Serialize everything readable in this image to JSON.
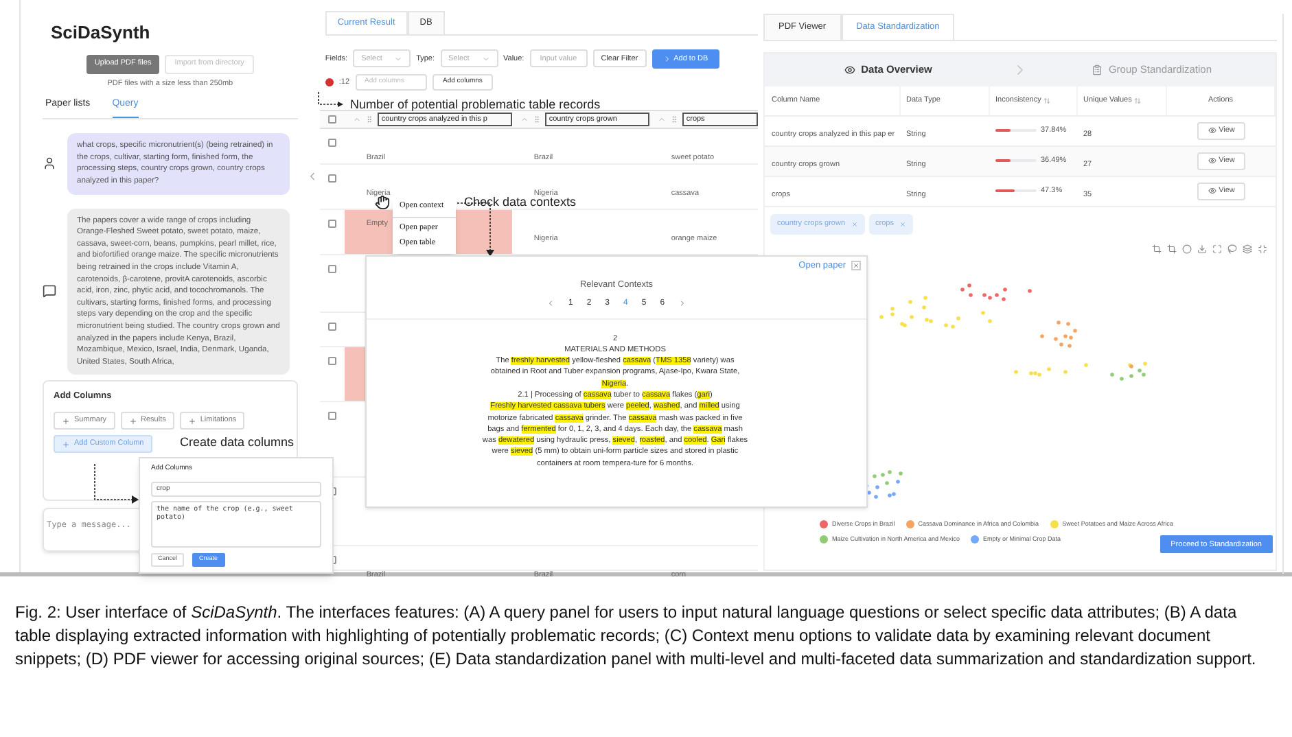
{
  "left_panel": {
    "title": "SciDaSynth",
    "buttons": [
      {
        "label": "Upload PDF files",
        "disabled": false
      },
      {
        "label": "Import from directory",
        "disabled": true
      }
    ],
    "hint": "PDF files with a size less than 250mb",
    "tabs": [
      {
        "label": "Paper lists",
        "selected": false
      },
      {
        "label": "Query",
        "selected": true
      }
    ],
    "messages": [
      {
        "kind": "user",
        "text": "what crops, specific micronutrient(s) (being retrained) in the crops, cultivar, starting form, finished form, the processing steps, country crops grown, country crops analyzed in this paper?"
      },
      {
        "kind": "bot",
        "text": "The papers cover a wide range of crops including Orange-Fleshed Sweet potato, sweet potato, maize, cassava, sweet-corn, beans, pumpkins, pearl millet, rice, and biofortified orange maize. The specific micronutrients being retrained in the crops include Vitamin A, carotenoids, β-carotene, provitA carotenoids, ascorbic acid, iron, zinc, phytic acid, and tocochromanols. The cultivars, starting forms, finished forms, and processing steps vary depending on the crop and the specific micronutrient being studied. The country crops grown and analyzed in the papers include Kenya, Brazil, Mozambique, Mexico, Israel, India, Denmark, Uganda, United States, South Africa,"
      }
    ],
    "add_columns": {
      "title": "Add Columns",
      "buttons": [
        {
          "label": "Summary",
          "kind": "preset"
        },
        {
          "label": "Results",
          "kind": "preset"
        },
        {
          "label": "Limitations",
          "kind": "preset"
        },
        {
          "label": "Add Custom Column",
          "kind": "custom"
        }
      ]
    },
    "message_input": {
      "placeholder": "Type a message..."
    }
  },
  "add_columns_dialog": {
    "title": "Add Columns",
    "name_value": "crop",
    "description_value": "the name of the crop (e.g., sweet potato)",
    "buttons": [
      {
        "label": "Cancel",
        "kind": "secondary"
      },
      {
        "label": "Create",
        "kind": "primary"
      }
    ]
  },
  "middle_panel": {
    "tabs": [
      {
        "label": "Current Result",
        "selected": true
      },
      {
        "label": "DB",
        "selected": false
      }
    ],
    "filters": [
      {
        "label": "Fields:",
        "kind": "select",
        "placeholder": "Select"
      },
      {
        "label": "Type:",
        "kind": "select",
        "placeholder": "Select"
      },
      {
        "label": "Value:",
        "kind": "input",
        "placeholder": "Input value"
      }
    ],
    "clear_filter": "Clear Filter",
    "add_to_db": "Add to DB",
    "problem_count": ":12",
    "add_columns_placeholder": "Add columns",
    "add_columns_button": "Add columns",
    "table": {
      "columns": [
        "country crops analyzed in this p",
        "country crops grown",
        "crops"
      ],
      "select_all_checked": false,
      "rows": [
        {
          "checked": false,
          "flagged": false,
          "cells": [
            "Brazil",
            "Brazil",
            "sweet potato"
          ]
        },
        {
          "checked": false,
          "flagged": false,
          "cells": [
            "Nigeria",
            "Nigeria",
            "cassava"
          ]
        },
        {
          "checked": false,
          "flagged": true,
          "cells": [
            "Empty",
            "Nigeria",
            "orange maize"
          ]
        },
        {
          "checked": false,
          "flagged": false
        },
        {
          "checked": false,
          "flagged": false
        },
        {
          "checked": false,
          "flagged": true
        },
        {
          "checked": false,
          "flagged": false
        },
        {
          "checked": false,
          "flagged": false
        },
        {
          "checked": false,
          "flagged": false,
          "cells": [
            "Brazil",
            "Brazil",
            "corn"
          ]
        }
      ]
    }
  },
  "context_menu": {
    "items": [
      "Open context",
      "Open paper",
      "Open table"
    ]
  },
  "contexts_popup": {
    "open_paper": "Open paper",
    "title": "Relevant Contexts",
    "pages": [
      {
        "label": "1",
        "selected": false
      },
      {
        "label": "2",
        "selected": false
      },
      {
        "label": "3",
        "selected": false
      },
      {
        "label": "4",
        "selected": true
      },
      {
        "label": "5",
        "selected": false
      },
      {
        "label": "6",
        "selected": false
      }
    ],
    "paragraphs": [
      [
        {
          "text": "2",
          "highlighted": false
        }
      ],
      [
        {
          "text": "MATERIALS AND METHODS",
          "highlighted": false
        }
      ],
      [
        {
          "text": "The ",
          "highlighted": false
        },
        {
          "text": "freshly harvested",
          "highlighted": true
        },
        {
          "text": " yellow-fleshed ",
          "highlighted": false
        },
        {
          "text": "cassava",
          "highlighted": true
        },
        {
          "text": " (",
          "highlighted": false
        },
        {
          "text": "TMS 1358",
          "highlighted": true
        },
        {
          "text": " variety) was obtained in Root and Tuber expansion programs, Ajase-Ipo, Kwara State, ",
          "highlighted": false
        },
        {
          "text": "Nigeria",
          "highlighted": true
        },
        {
          "text": ".",
          "highlighted": false
        }
      ],
      [
        {
          "text": "2.1 | Processing of ",
          "highlighted": false
        },
        {
          "text": "cassava",
          "highlighted": true
        },
        {
          "text": " tuber to ",
          "highlighted": false
        },
        {
          "text": "cassava",
          "highlighted": true
        },
        {
          "text": " flakes (",
          "highlighted": false
        },
        {
          "text": "gari",
          "highlighted": true
        },
        {
          "text": ")",
          "highlighted": false
        }
      ],
      [
        {
          "text": "Freshly harvested cassava tubers",
          "highlighted": true
        },
        {
          "text": " were ",
          "highlighted": false
        },
        {
          "text": "peeled",
          "highlighted": true
        },
        {
          "text": ", ",
          "highlighted": false
        },
        {
          "text": "washed",
          "highlighted": true
        },
        {
          "text": ", and ",
          "highlighted": false
        },
        {
          "text": "milled",
          "highlighted": true
        },
        {
          "text": " using motorize fabricated ",
          "highlighted": false
        },
        {
          "text": "cassava",
          "highlighted": true
        },
        {
          "text": " grinder. The ",
          "highlighted": false
        },
        {
          "text": "cassava",
          "highlighted": true
        },
        {
          "text": " mash was packed in five bags and ",
          "highlighted": false
        },
        {
          "text": "fermented",
          "highlighted": true
        },
        {
          "text": " for 0, 1, 2, 3, and 4 days. Each day, the ",
          "highlighted": false
        },
        {
          "text": "cassava",
          "highlighted": true
        },
        {
          "text": " mash was ",
          "highlighted": false
        },
        {
          "text": "dewatered",
          "highlighted": true
        },
        {
          "text": " using hydraulic press, ",
          "highlighted": false
        },
        {
          "text": "sieved",
          "highlighted": true
        },
        {
          "text": ", ",
          "highlighted": false
        },
        {
          "text": "roasted",
          "highlighted": true
        },
        {
          "text": ", and ",
          "highlighted": false
        },
        {
          "text": "cooled",
          "highlighted": true
        },
        {
          "text": ". ",
          "highlighted": false
        },
        {
          "text": "Gari",
          "highlighted": true
        },
        {
          "text": " flakes were ",
          "highlighted": false
        },
        {
          "text": "sieved",
          "highlighted": true
        },
        {
          "text": " (5 mm) to obtain uni-form particle sizes and stored in plastic containers at room tempera-ture for 6 months.",
          "highlighted": false
        }
      ]
    ]
  },
  "annotations": [
    {
      "kind": "records",
      "text": "Number of potential problematic table records"
    },
    {
      "kind": "contexts",
      "text": "Check data contexts"
    },
    {
      "kind": "columns",
      "text": "Create data columns"
    }
  ],
  "right_panel": {
    "tabs": [
      {
        "label": "PDF Viewer",
        "selected": false
      },
      {
        "label": "Data Standardization",
        "selected": true
      }
    ],
    "steps": [
      {
        "label": "Data Overview",
        "selected": true
      },
      {
        "label": "Group Standardization",
        "selected": false
      }
    ],
    "table": {
      "columns": [
        "Column Name",
        "Data Type",
        "Inconsistency",
        "Unique Values",
        "Actions"
      ],
      "rows": [
        {
          "name": "country crops analyzed in this pap er",
          "type": "String",
          "level": 0.3784,
          "reading": "37.84%",
          "unique": "28",
          "action": "View"
        },
        {
          "name": "country crops grown",
          "type": "String",
          "level": 0.3649,
          "reading": "36.49%",
          "unique": "27",
          "action": "View"
        },
        {
          "name": "crops",
          "type": "String",
          "level": 0.473,
          "reading": "47.3%",
          "unique": "35",
          "action": "View"
        }
      ]
    },
    "tags": [
      {
        "label": "country crops grown"
      },
      {
        "label": "crops"
      }
    ],
    "legend": [
      {
        "label": "Diverse Crops in Brazil",
        "color": "#ee6666"
      },
      {
        "label": "Cassava Dominance in Africa and Colombia",
        "color": "#f4a460"
      },
      {
        "label": "Sweet Potatoes and Maize Across Africa",
        "color": "#f7e04a"
      },
      {
        "label": "Maize Cultivation in North America and Mexico",
        "color": "#91cc75"
      },
      {
        "label": "Empty or Minimal Crop Data",
        "color": "#73a8ff"
      }
    ],
    "proceed_button": "Proceed to Standardization"
  },
  "caption": "Fig. 2: User interface of *SciDaSynth*. The interfaces features: (A) A query panel for users to input natural language questions or select specific data attributes; (B) A data table displaying extracted information with highlighting of potentially problematic records; (C) Context menu options to validate data by examining relevant document snippets; (D) PDF viewer for accessing original sources; (E) Data standardization panel with multi-level and multi-faceted data summarization and standardization support."
}
